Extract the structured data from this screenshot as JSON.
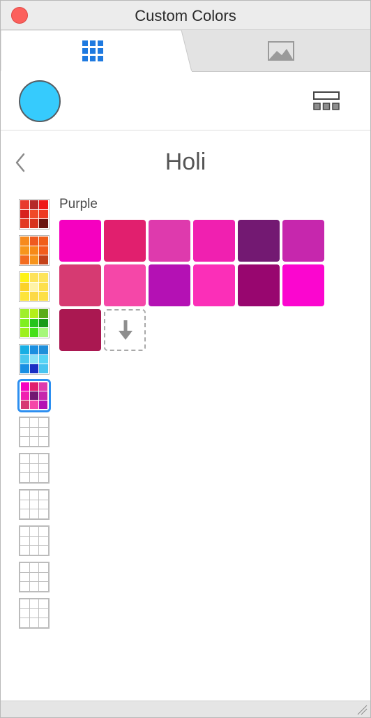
{
  "window": {
    "title": "Custom Colors"
  },
  "tabs": [
    {
      "name": "palettes",
      "icon": "grid-icon",
      "active": true
    },
    {
      "name": "image",
      "icon": "image-icon",
      "active": false
    }
  ],
  "toolbar": {
    "current_color": "#36cbfd",
    "layout_icon": "layout-icon"
  },
  "header": {
    "title": "Holi",
    "back_icon": "chevron-left-icon"
  },
  "palettes": [
    {
      "colors": [
        "#e8392c",
        "#b52a2a",
        "#ef1a1a",
        "#d8201e",
        "#f04a28",
        "#ee3a22",
        "#e33b24",
        "#d8321e",
        "#6a1410"
      ]
    },
    {
      "colors": [
        "#f78a1d",
        "#ef5a20",
        "#f05e1a",
        "#f7961d",
        "#f68a18",
        "#f25d1c",
        "#f36c20",
        "#f6941c",
        "#c4421a"
      ]
    },
    {
      "colors": [
        "#fef216",
        "#fde25a",
        "#fde45c",
        "#fbd22a",
        "#fff3a8",
        "#fde04e",
        "#fde43a",
        "#fcd946",
        "#fde046"
      ]
    },
    {
      "colors": [
        "#9fef2b",
        "#b4ef1a",
        "#5aac1a",
        "#80ef20",
        "#26c41c",
        "#1a9a1a",
        "#9df01e",
        "#46e01a",
        "#a6f77a"
      ]
    },
    {
      "colors": [
        "#17aee4",
        "#1a8fe0",
        "#1f8fd9",
        "#4bc8ef",
        "#8be2f7",
        "#57d4f5",
        "#1a8fe3",
        "#1a2fc4",
        "#48c4f0"
      ]
    },
    {
      "colors": [
        "#f500c0",
        "#e11f6e",
        "#de3aad",
        "#f020b0",
        "#731972",
        "#c627ad",
        "#d63a72",
        "#f547a8",
        "#b411b4"
      ],
      "selected": true
    },
    {
      "colors": []
    },
    {
      "colors": []
    },
    {
      "colors": []
    },
    {
      "colors": []
    },
    {
      "colors": []
    },
    {
      "colors": []
    }
  ],
  "group": {
    "name": "Purple",
    "swatches": [
      "#f500c0",
      "#e11f6e",
      "#de3aad",
      "#f020b0",
      "#731972",
      "#c627ad",
      "#d63a72",
      "#f547a8",
      "#b411b4",
      "#fb2fb8",
      "#98066f",
      "#fb06cf",
      "#aa1851"
    ]
  },
  "add_slot": {
    "icon": "arrow-down-icon"
  }
}
